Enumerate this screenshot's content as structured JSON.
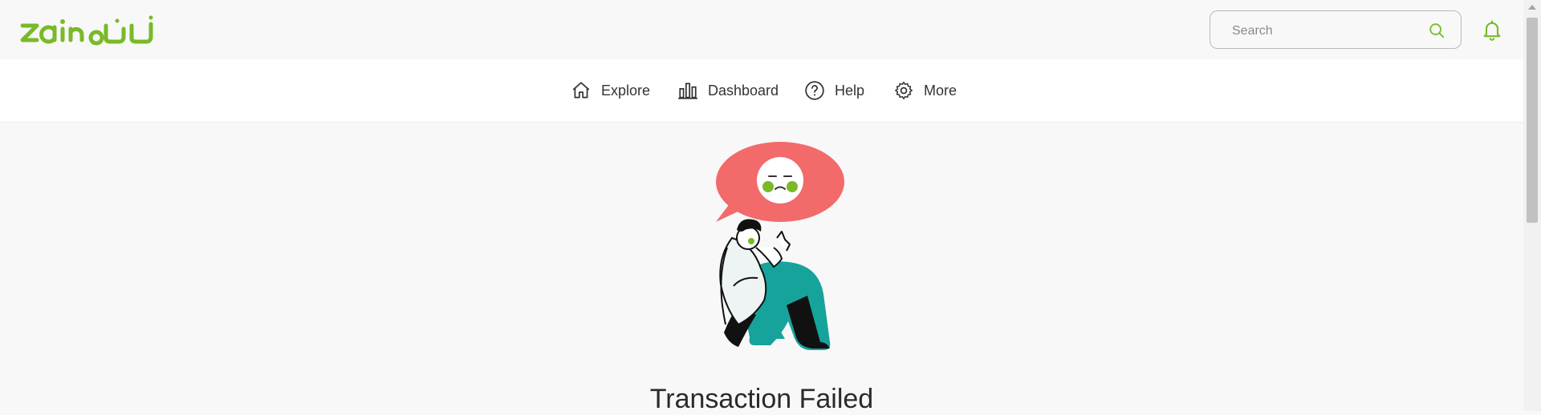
{
  "header": {
    "logo_text": "zain زين",
    "search": {
      "placeholder": "Search",
      "value": ""
    },
    "icons": [
      "search-icon",
      "bell-icon"
    ]
  },
  "nav": {
    "items": [
      {
        "label": "Explore",
        "icon": "home-icon"
      },
      {
        "label": "Dashboard",
        "icon": "bar-chart-icon"
      },
      {
        "label": "Help",
        "icon": "question-circle-icon"
      },
      {
        "label": "More",
        "icon": "gear-icon"
      }
    ]
  },
  "main": {
    "title": "Transaction Failed"
  },
  "colors": {
    "brand_green": "#7ab929",
    "speech_red": "#f26a6a",
    "teal": "#16a39c"
  }
}
